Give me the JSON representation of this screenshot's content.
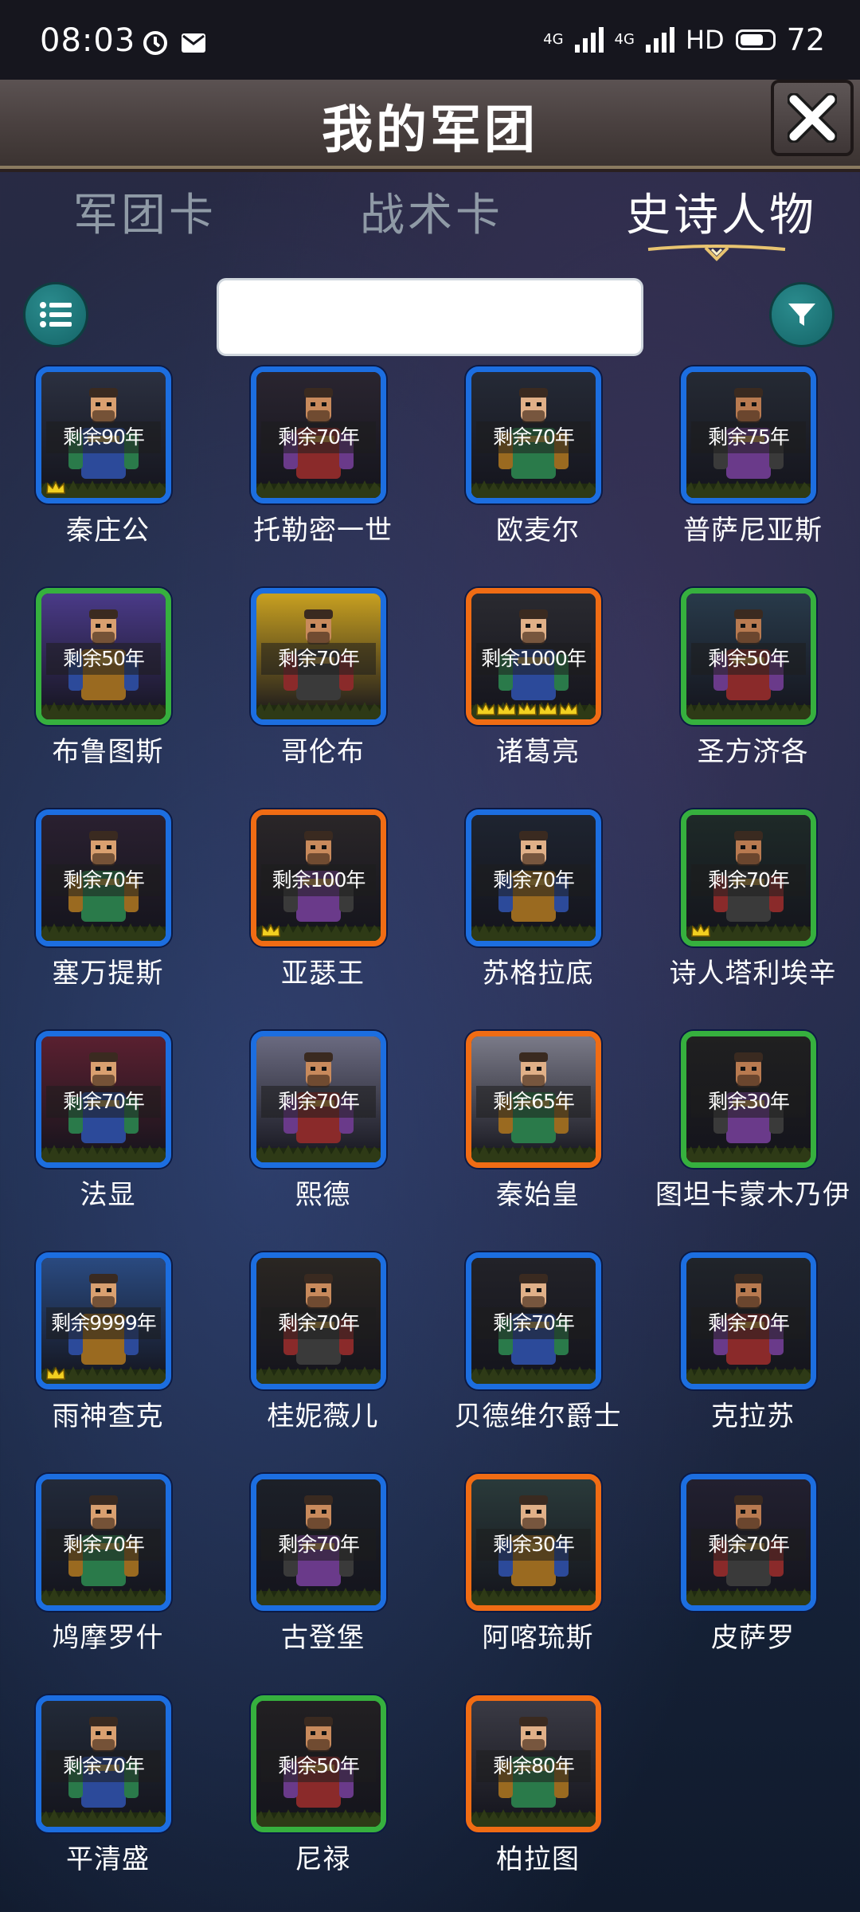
{
  "status_bar": {
    "time": "08:03",
    "network_left": "4G",
    "network_right": "4G",
    "hd": "HD",
    "battery": "72"
  },
  "header": {
    "title": "我的军团"
  },
  "tabs": [
    {
      "label": "军团卡"
    },
    {
      "label": "战术卡"
    },
    {
      "label": "史诗人物"
    }
  ],
  "active_tab": 2,
  "search": {
    "value": "",
    "placeholder": ""
  },
  "colors": {
    "rarity_blue": "#1c6ee0",
    "rarity_green": "#36b03e",
    "rarity_orange": "#f06c14",
    "teal_button": "#1f7f82"
  },
  "characters": [
    {
      "name": "秦庄公",
      "remaining": "剩余90年",
      "rarity": "blue",
      "crowns": 1,
      "bg": "#2b3040"
    },
    {
      "name": "托勒密一世",
      "remaining": "剩余70年",
      "rarity": "blue",
      "crowns": 0,
      "bg": "#2a2530"
    },
    {
      "name": "欧麦尔",
      "remaining": "剩余70年",
      "rarity": "blue",
      "crowns": 0,
      "bg": "#252a36"
    },
    {
      "name": "普萨尼亚斯",
      "remaining": "剩余75年",
      "rarity": "blue",
      "crowns": 0,
      "bg": "#252a34"
    },
    {
      "name": "布鲁图斯",
      "remaining": "剩余50年",
      "rarity": "green",
      "crowns": 0,
      "bg": "#4a3a88"
    },
    {
      "name": "哥伦布",
      "remaining": "剩余70年",
      "rarity": "blue",
      "crowns": 0,
      "bg": "#c8a020"
    },
    {
      "name": "诸葛亮",
      "remaining": "剩余1000年",
      "rarity": "orange",
      "crowns": 5,
      "bg": "#2a2a30"
    },
    {
      "name": "圣方济各",
      "remaining": "剩余50年",
      "rarity": "green",
      "crowns": 0,
      "bg": "#283a4a"
    },
    {
      "name": "塞万提斯",
      "remaining": "剩余70年",
      "rarity": "blue",
      "crowns": 0,
      "bg": "#2a2030"
    },
    {
      "name": "亚瑟王",
      "remaining": "剩余100年",
      "rarity": "orange",
      "crowns": 1,
      "bg": "#2a2628"
    },
    {
      "name": "苏格拉底",
      "remaining": "剩余70年",
      "rarity": "blue",
      "crowns": 0,
      "bg": "#1e2430"
    },
    {
      "name": "诗人塔利埃辛",
      "remaining": "剩余70年",
      "rarity": "green",
      "crowns": 1,
      "bg": "#1e2a28"
    },
    {
      "name": "法显",
      "remaining": "剩余70年",
      "rarity": "blue",
      "crowns": 0,
      "bg": "#5a2030"
    },
    {
      "name": "熙德",
      "remaining": "剩余70年",
      "rarity": "blue",
      "crowns": 0,
      "bg": "#6a6a80"
    },
    {
      "name": "秦始皇",
      "remaining": "剩余65年",
      "rarity": "orange",
      "crowns": 0,
      "bg": "#7a7a88"
    },
    {
      "name": "图坦卡蒙木乃伊",
      "remaining": "剩余30年",
      "rarity": "green",
      "crowns": 0,
      "bg": "#202020"
    },
    {
      "name": "雨神查克",
      "remaining": "剩余9999年",
      "rarity": "blue",
      "crowns": 1,
      "bg": "#2a4a80"
    },
    {
      "name": "桂妮薇儿",
      "remaining": "剩余70年",
      "rarity": "blue",
      "crowns": 0,
      "bg": "#2a2622"
    },
    {
      "name": "贝德维尔爵士",
      "remaining": "剩余70年",
      "rarity": "blue",
      "crowns": 0,
      "bg": "#222228"
    },
    {
      "name": "克拉苏",
      "remaining": "剩余70年",
      "rarity": "blue",
      "crowns": 0,
      "bg": "#20242a"
    },
    {
      "name": "鸠摩罗什",
      "remaining": "剩余70年",
      "rarity": "blue",
      "crowns": 0,
      "bg": "#222a3a"
    },
    {
      "name": "古登堡",
      "remaining": "剩余70年",
      "rarity": "blue",
      "crowns": 0,
      "bg": "#1c2028"
    },
    {
      "name": "阿喀琉斯",
      "remaining": "剩余30年",
      "rarity": "orange",
      "crowns": 0,
      "bg": "#2a3a3a"
    },
    {
      "name": "皮萨罗",
      "remaining": "剩余70年",
      "rarity": "blue",
      "crowns": 0,
      "bg": "#222030"
    },
    {
      "name": "平清盛",
      "remaining": "剩余70年",
      "rarity": "blue",
      "crowns": 0,
      "bg": "#222a38"
    },
    {
      "name": "尼禄",
      "remaining": "剩余50年",
      "rarity": "green",
      "crowns": 0,
      "bg": "#222022"
    },
    {
      "name": "柏拉图",
      "remaining": "剩余80年",
      "rarity": "orange",
      "crowns": 0,
      "bg": "#3a3a44"
    }
  ]
}
